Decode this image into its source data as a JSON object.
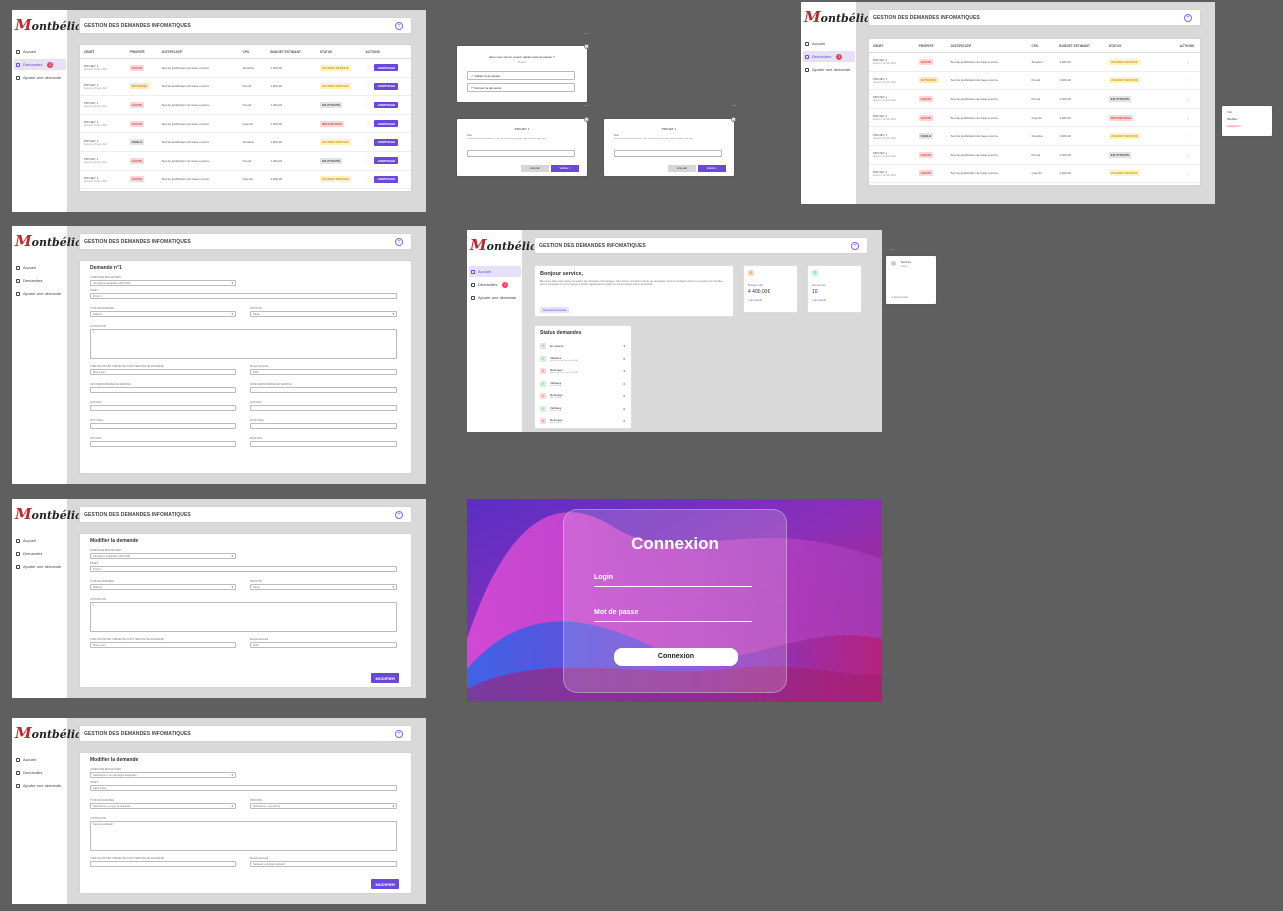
{
  "app": {
    "header_title": "GESTION DES DEMANDES INFOMATIQUES",
    "nav": {
      "home": "Accueil",
      "requests": "Demandes",
      "add": "Ajouter une demande",
      "badge": "2"
    }
  },
  "table": {
    "columns": [
      "OBJET",
      "PRIORITÉ",
      "JUSTIFICATIF",
      "CPU",
      "BUDGET ESTIMANT",
      "STATUS",
      "ACTIONS"
    ],
    "action_label": "ARBITRAGE",
    "rows": [
      {
        "objet": "PROJET 1",
        "sub": "Ajouté le 20 juin 2021",
        "priority": "HAUTE",
        "just": "Text de justification de base a écrire",
        "cpu": "Simeline",
        "budget": "1 200,00",
        "status": "VALIDER SERVICE"
      },
      {
        "objet": "PROJET 1",
        "sub": "Ajouté le 20 juin 2021",
        "priority": "MOYENNE",
        "just": "Text de justification de base a écrire",
        "cpu": "Pound",
        "budget": "1 200,00",
        "status": "VALIDER SERVICE"
      },
      {
        "objet": "PROJET 1",
        "sub": "Ajouté le 20 juin 2021",
        "priority": "HAUTE",
        "just": "Text de justification de base a écrire",
        "cpu": "Pound",
        "budget": "1 200,00",
        "status": "EN ATTENTE"
      },
      {
        "objet": "PROJET 1",
        "sub": "Ajouté le 20 juin 2021",
        "priority": "HAUTE",
        "just": "Text de justification de base a écrire",
        "cpu": "Quentin",
        "budget": "1 200,00",
        "status": "REFUSE DSIA"
      },
      {
        "objet": "PROJET 1",
        "sub": "Ajouté le 20 juin 2021",
        "priority": "FAIBLE",
        "just": "Text de justification de base a écrire",
        "cpu": "Simeline",
        "budget": "1 200,00",
        "status": "VALIDER SERVICE"
      },
      {
        "objet": "PROJET 1",
        "sub": "Ajouté le 20 juin 2021",
        "priority": "HAUTE",
        "just": "Text de justification de base a écrire",
        "cpu": "Pound",
        "budget": "1 200,00",
        "status": "EN ATTENTE"
      },
      {
        "objet": "PROJET 1",
        "sub": "Ajouté le 20 juin 2021",
        "priority": "HAUTE",
        "just": "Text de justification de base a écrire",
        "cpu": "Quentin",
        "budget": "1 200,00",
        "status": "VALIDER SERVICE"
      }
    ]
  },
  "form": {
    "title_view": "Demande n°1",
    "title_edit": "Modifier la demande",
    "campaign_label": "CAMPAGNE BUDGETAIRE",
    "campaign_value": "Campagne budgétaire 2020-2021",
    "campaign_placeholder": "Sélectionner une campagne budgétaire",
    "objet_label": "OBJET",
    "objet_value": "Projet 1",
    "objet_placeholder": "Saisir l'objet",
    "type_label": "TYPE DE DEMANDE",
    "type_value": "Matériel",
    "type_placeholder": "Sélectionner un type de demande",
    "prio_label": "PRIORITÉ",
    "prio_value": "Haute",
    "prio_placeholder": "Sélectionner une priorité",
    "just_label": "JUSTIFICATIF",
    "just_value": "1",
    "just_placeholder": "Saisir le justificatif",
    "chef_label": "CHEF DE PROJET PRESENTE (C'EST SERVICE DE RANGEUR)",
    "chef_value": "Mme Lauer",
    "budget_label": "Budget Estimatif",
    "budget_value": "2000",
    "budget_placeholder": "Saisissez le budget estimatif",
    "avis_resp_label": "AVIS RESPONSABLE DE SERVICE",
    "date_resp_label": "DATE RESPONSABLE DE SERVICE",
    "avis_dsia_label": "AVIS DSIA",
    "date_dsia_label": "AVIS DSIA",
    "avis_ccm_label": "AVIS SICEL",
    "date_ccm_label": "DATE SICEL",
    "avis_des_label": "AVIS DES",
    "date_des_label": "DATE DES",
    "modify_btn": "MODIFIER"
  },
  "dialogs": {
    "confirm_title": "Etes-vous sûr de vouloir valider cette demande ?",
    "confirm_sub": "Projet 1",
    "validate": "Valider la demande",
    "refuse": "Refuser la demande",
    "project": "PROJET 1",
    "note_label": "Avis",
    "note_text": "Vous vous rendez demande le n° des du résultat du projet que vous souhaitez entre avis",
    "cancel": "Annuler",
    "submit": "Valider",
    "dots": "..."
  },
  "menu": {
    "items": [
      "Voir",
      "Modifier",
      "Supprimer"
    ]
  },
  "dashboard": {
    "greeting": "Bonjour service,",
    "intro": "Bienvenue dans votre espace de gestion des demandes informatiques. Vous pouvez consulter l'état de vos demandes, suivre les budgets estimés et en ajouter de nouvelles pour la campagne en cours. Pensez à vérifier régulièrement le statut de vos demandes auprès de la DSIA.",
    "btn": "Nouvelle demande",
    "budget_label": "Budget total",
    "budget_value": "4 400,00€",
    "budget_link": "+ En savoir",
    "req_label": "Demandes",
    "req_value": "10",
    "req_link": "+ En savoir",
    "status_title": "Status demandes",
    "statuses": [
      {
        "label": "En attente",
        "sub": "",
        "count": "3"
      },
      {
        "label": "Validées",
        "sub": "par le service et par la DSIA",
        "count": "6"
      },
      {
        "label": "Refusées",
        "sub": "par le service et par la DSIA",
        "count": "3"
      },
      {
        "label": "Validées",
        "sub": "par la DSIA",
        "count": "0"
      },
      {
        "label": "Refusées",
        "sub": "par la DSIA",
        "count": "0"
      },
      {
        "label": "Validées",
        "sub": "par le CCM",
        "count": "0"
      },
      {
        "label": "Refusées",
        "sub": "par le CCM",
        "count": "0"
      }
    ]
  },
  "user_menu": {
    "name": "Service",
    "role": "Admin",
    "logout": "Déconnexion"
  },
  "login": {
    "title": "Connexion",
    "login": "Login",
    "password": "Mot de passe",
    "button": "Connexion"
  }
}
